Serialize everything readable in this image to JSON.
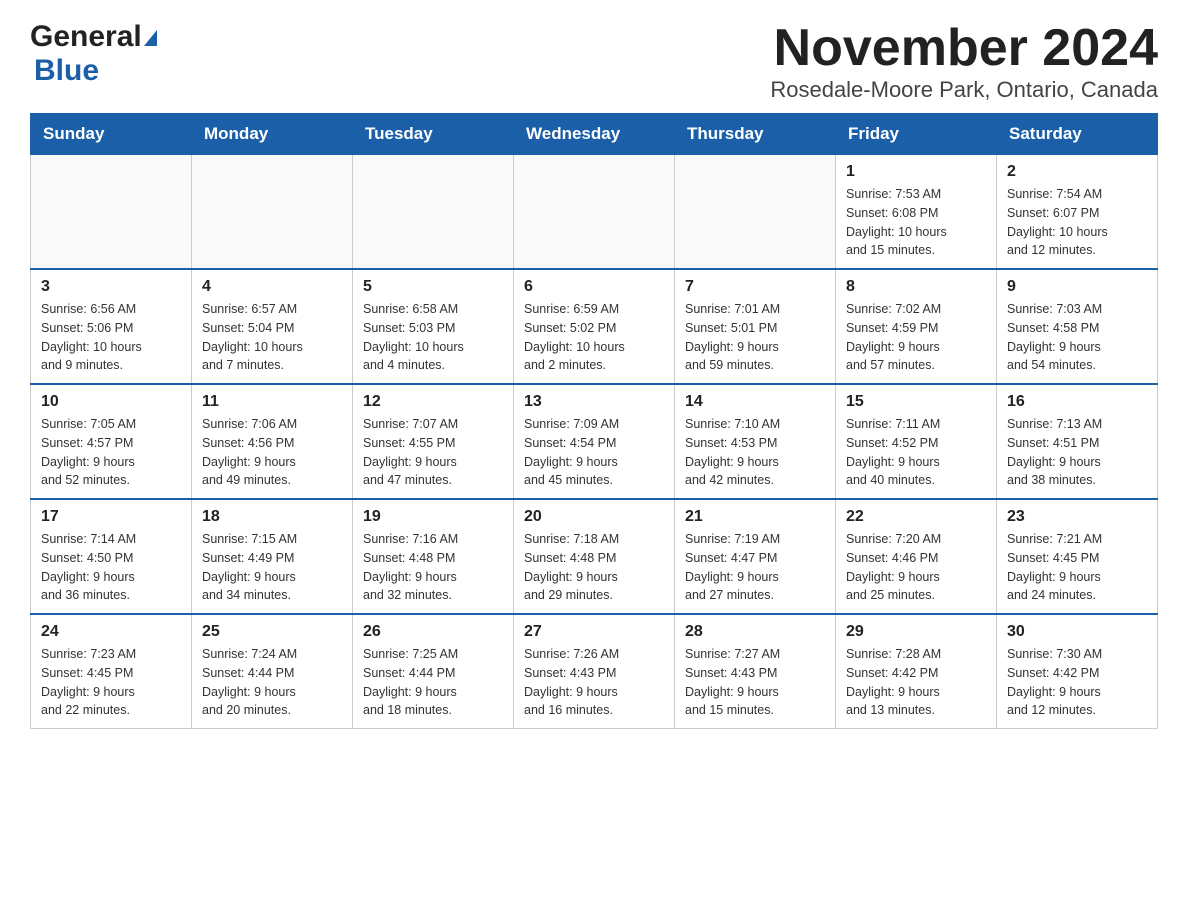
{
  "header": {
    "logo_general": "General",
    "logo_blue": "Blue",
    "title": "November 2024",
    "subtitle": "Rosedale-Moore Park, Ontario, Canada"
  },
  "days_of_week": [
    "Sunday",
    "Monday",
    "Tuesday",
    "Wednesday",
    "Thursday",
    "Friday",
    "Saturday"
  ],
  "weeks": [
    {
      "days": [
        {
          "num": "",
          "info": ""
        },
        {
          "num": "",
          "info": ""
        },
        {
          "num": "",
          "info": ""
        },
        {
          "num": "",
          "info": ""
        },
        {
          "num": "",
          "info": ""
        },
        {
          "num": "1",
          "info": "Sunrise: 7:53 AM\nSunset: 6:08 PM\nDaylight: 10 hours\nand 15 minutes."
        },
        {
          "num": "2",
          "info": "Sunrise: 7:54 AM\nSunset: 6:07 PM\nDaylight: 10 hours\nand 12 minutes."
        }
      ]
    },
    {
      "days": [
        {
          "num": "3",
          "info": "Sunrise: 6:56 AM\nSunset: 5:06 PM\nDaylight: 10 hours\nand 9 minutes."
        },
        {
          "num": "4",
          "info": "Sunrise: 6:57 AM\nSunset: 5:04 PM\nDaylight: 10 hours\nand 7 minutes."
        },
        {
          "num": "5",
          "info": "Sunrise: 6:58 AM\nSunset: 5:03 PM\nDaylight: 10 hours\nand 4 minutes."
        },
        {
          "num": "6",
          "info": "Sunrise: 6:59 AM\nSunset: 5:02 PM\nDaylight: 10 hours\nand 2 minutes."
        },
        {
          "num": "7",
          "info": "Sunrise: 7:01 AM\nSunset: 5:01 PM\nDaylight: 9 hours\nand 59 minutes."
        },
        {
          "num": "8",
          "info": "Sunrise: 7:02 AM\nSunset: 4:59 PM\nDaylight: 9 hours\nand 57 minutes."
        },
        {
          "num": "9",
          "info": "Sunrise: 7:03 AM\nSunset: 4:58 PM\nDaylight: 9 hours\nand 54 minutes."
        }
      ]
    },
    {
      "days": [
        {
          "num": "10",
          "info": "Sunrise: 7:05 AM\nSunset: 4:57 PM\nDaylight: 9 hours\nand 52 minutes."
        },
        {
          "num": "11",
          "info": "Sunrise: 7:06 AM\nSunset: 4:56 PM\nDaylight: 9 hours\nand 49 minutes."
        },
        {
          "num": "12",
          "info": "Sunrise: 7:07 AM\nSunset: 4:55 PM\nDaylight: 9 hours\nand 47 minutes."
        },
        {
          "num": "13",
          "info": "Sunrise: 7:09 AM\nSunset: 4:54 PM\nDaylight: 9 hours\nand 45 minutes."
        },
        {
          "num": "14",
          "info": "Sunrise: 7:10 AM\nSunset: 4:53 PM\nDaylight: 9 hours\nand 42 minutes."
        },
        {
          "num": "15",
          "info": "Sunrise: 7:11 AM\nSunset: 4:52 PM\nDaylight: 9 hours\nand 40 minutes."
        },
        {
          "num": "16",
          "info": "Sunrise: 7:13 AM\nSunset: 4:51 PM\nDaylight: 9 hours\nand 38 minutes."
        }
      ]
    },
    {
      "days": [
        {
          "num": "17",
          "info": "Sunrise: 7:14 AM\nSunset: 4:50 PM\nDaylight: 9 hours\nand 36 minutes."
        },
        {
          "num": "18",
          "info": "Sunrise: 7:15 AM\nSunset: 4:49 PM\nDaylight: 9 hours\nand 34 minutes."
        },
        {
          "num": "19",
          "info": "Sunrise: 7:16 AM\nSunset: 4:48 PM\nDaylight: 9 hours\nand 32 minutes."
        },
        {
          "num": "20",
          "info": "Sunrise: 7:18 AM\nSunset: 4:48 PM\nDaylight: 9 hours\nand 29 minutes."
        },
        {
          "num": "21",
          "info": "Sunrise: 7:19 AM\nSunset: 4:47 PM\nDaylight: 9 hours\nand 27 minutes."
        },
        {
          "num": "22",
          "info": "Sunrise: 7:20 AM\nSunset: 4:46 PM\nDaylight: 9 hours\nand 25 minutes."
        },
        {
          "num": "23",
          "info": "Sunrise: 7:21 AM\nSunset: 4:45 PM\nDaylight: 9 hours\nand 24 minutes."
        }
      ]
    },
    {
      "days": [
        {
          "num": "24",
          "info": "Sunrise: 7:23 AM\nSunset: 4:45 PM\nDaylight: 9 hours\nand 22 minutes."
        },
        {
          "num": "25",
          "info": "Sunrise: 7:24 AM\nSunset: 4:44 PM\nDaylight: 9 hours\nand 20 minutes."
        },
        {
          "num": "26",
          "info": "Sunrise: 7:25 AM\nSunset: 4:44 PM\nDaylight: 9 hours\nand 18 minutes."
        },
        {
          "num": "27",
          "info": "Sunrise: 7:26 AM\nSunset: 4:43 PM\nDaylight: 9 hours\nand 16 minutes."
        },
        {
          "num": "28",
          "info": "Sunrise: 7:27 AM\nSunset: 4:43 PM\nDaylight: 9 hours\nand 15 minutes."
        },
        {
          "num": "29",
          "info": "Sunrise: 7:28 AM\nSunset: 4:42 PM\nDaylight: 9 hours\nand 13 minutes."
        },
        {
          "num": "30",
          "info": "Sunrise: 7:30 AM\nSunset: 4:42 PM\nDaylight: 9 hours\nand 12 minutes."
        }
      ]
    }
  ]
}
